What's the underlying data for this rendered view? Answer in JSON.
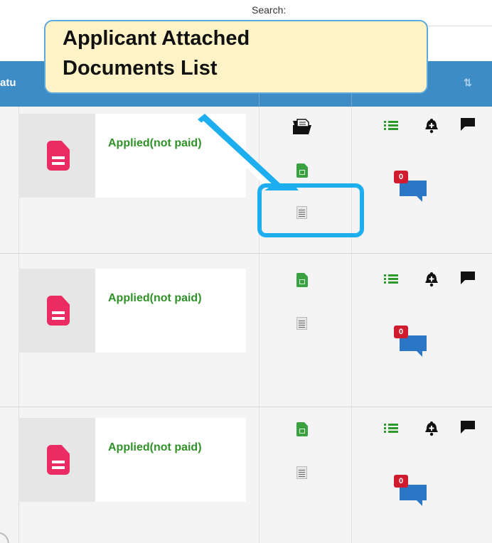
{
  "search": {
    "label": "Search:"
  },
  "header": {
    "status_column": "atu",
    "sort_icon": "⇅"
  },
  "callout": {
    "line1": "Applicant Attached",
    "line2": "Documents List"
  },
  "rows": [
    {
      "status": "Applied(not paid)",
      "documents": [
        "folder-open-icon",
        "spreadsheet-icon",
        "text-file-icon"
      ],
      "actions": [
        "list-icon",
        "add-alert-bell-icon",
        "message-icon"
      ],
      "chat_count": "0"
    },
    {
      "status": "Applied(not paid)",
      "documents": [
        "spreadsheet-icon",
        "text-file-icon"
      ],
      "actions": [
        "list-icon",
        "add-alert-bell-icon",
        "message-icon"
      ],
      "chat_count": "0"
    },
    {
      "status": "Applied(not paid)",
      "documents": [
        "spreadsheet-icon",
        "text-file-icon"
      ],
      "actions": [
        "list-icon",
        "add-alert-bell-icon",
        "message-icon"
      ],
      "chat_count": "0"
    }
  ],
  "colors": {
    "header_bg": "#3d8cc5",
    "status_text": "#2f9128",
    "doc_icon": "#ea2c63",
    "chat_bubble": "#2b77c6",
    "badge": "#d01c2e",
    "callout_bg": "#fdf3c6",
    "highlight": "#1daef0"
  }
}
